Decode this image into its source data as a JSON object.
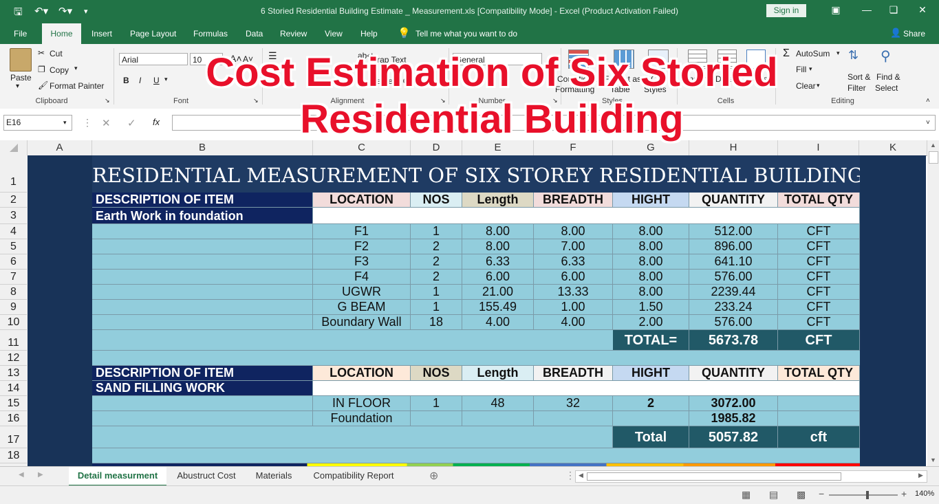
{
  "window": {
    "title": "6 Storied Residential Building Estimate _ Measurement.xls  [Compatibility Mode]  -  Excel (Product Activation Failed)",
    "sign_in": "Sign in",
    "share": "Share"
  },
  "ribbon_tabs": [
    "File",
    "Home",
    "Insert",
    "Page Layout",
    "Formulas",
    "Data",
    "Review",
    "View",
    "Help"
  ],
  "tell_me": "Tell me what you want to do",
  "clipboard": {
    "paste": "Paste",
    "cut": "Cut",
    "copy": "Copy",
    "format_painter": "Format Painter",
    "label": "Clipboard"
  },
  "font": {
    "name": "Arial",
    "size": "10",
    "bold": "B",
    "italic": "I",
    "underline": "U",
    "label": "Font"
  },
  "alignment": {
    "wrap": "Wrap Text",
    "merge": "Merge & Center",
    "label": "Alignment"
  },
  "number": {
    "format": "General",
    "label": "Number"
  },
  "styles": {
    "conditional": "Conditional",
    "conditional2": "Formatting",
    "format_as": "Format as",
    "table": "Table",
    "cell": "Cell",
    "cell_styles": "Styles",
    "label": "Styles"
  },
  "cells": {
    "insert": "Insert",
    "delete": "Delete",
    "format": "Format",
    "label": "Cells"
  },
  "editing": {
    "autosum": "AutoSum",
    "fill": "Fill",
    "clear": "Clear",
    "sort": "Sort &",
    "filter": "Filter",
    "find": "Find &",
    "select": "Select",
    "label": "Editing"
  },
  "formula_bar": {
    "name_box": "E16",
    "value": ""
  },
  "columns": [
    "A",
    "B",
    "C",
    "D",
    "E",
    "F",
    "G",
    "H",
    "I",
    "K"
  ],
  "rows": [
    "1",
    "2",
    "3",
    "4",
    "5",
    "6",
    "7",
    "8",
    "9",
    "10",
    "11",
    "12",
    "13",
    "14",
    "15",
    "16",
    "17",
    "18"
  ],
  "overlay": {
    "line1": "Cost Estimation of Six Storied",
    "line2": "Residential Building"
  },
  "sheet": {
    "title": "RESIDENTIAL MEASUREMENT OF SIX STOREY RESIDENTIAL BUILDING",
    "headers": [
      "DESCRIPTION OF ITEM",
      "LOCATION",
      "NOS",
      "Length",
      "BREADTH",
      "HIGHT",
      "QUANTITY",
      "TOTAL QTY"
    ],
    "section1": "Earth Work in foundation",
    "rows1": [
      [
        "F1",
        "1",
        "8.00",
        "8.00",
        "8.00",
        "512.00",
        "CFT"
      ],
      [
        "F2",
        "2",
        "8.00",
        "7.00",
        "8.00",
        "896.00",
        "CFT"
      ],
      [
        "F3",
        "2",
        "6.33",
        "6.33",
        "8.00",
        "641.10",
        "CFT"
      ],
      [
        "F4",
        "2",
        "6.00",
        "6.00",
        "8.00",
        "576.00",
        "CFT"
      ],
      [
        "UGWR",
        "1",
        "21.00",
        "13.33",
        "8.00",
        "2239.44",
        "CFT"
      ],
      [
        "G BEAM",
        "1",
        "155.49",
        "1.00",
        "1.50",
        "233.24",
        "CFT"
      ],
      [
        "Boundary Wall",
        "18",
        "4.00",
        "4.00",
        "2.00",
        "576.00",
        "CFT"
      ]
    ],
    "total1": {
      "label": "TOTAL=",
      "value": "5673.78",
      "unit": "CFT"
    },
    "section2": "SAND FILLING WORK",
    "rows2": [
      [
        "IN FLOOR",
        "1",
        "48",
        "32",
        "2",
        "3072.00",
        ""
      ],
      [
        "Foundation",
        "",
        "",
        "",
        "",
        "1985.82",
        ""
      ]
    ],
    "total2": {
      "label": "Total",
      "value": "5057.82",
      "unit": "cft"
    }
  },
  "sheet_tabs": [
    "Detail measurment",
    "Abustruct Cost",
    "Materials",
    "Compatibility Report"
  ],
  "zoom": "140%",
  "colors": {
    "excel_green": "#217346",
    "sheet_blue": "#183358",
    "cell_cyan": "#92cddc",
    "desc_navy": "#0f2460",
    "overlay_red": "#e8102a",
    "total_teal": "#215967"
  }
}
